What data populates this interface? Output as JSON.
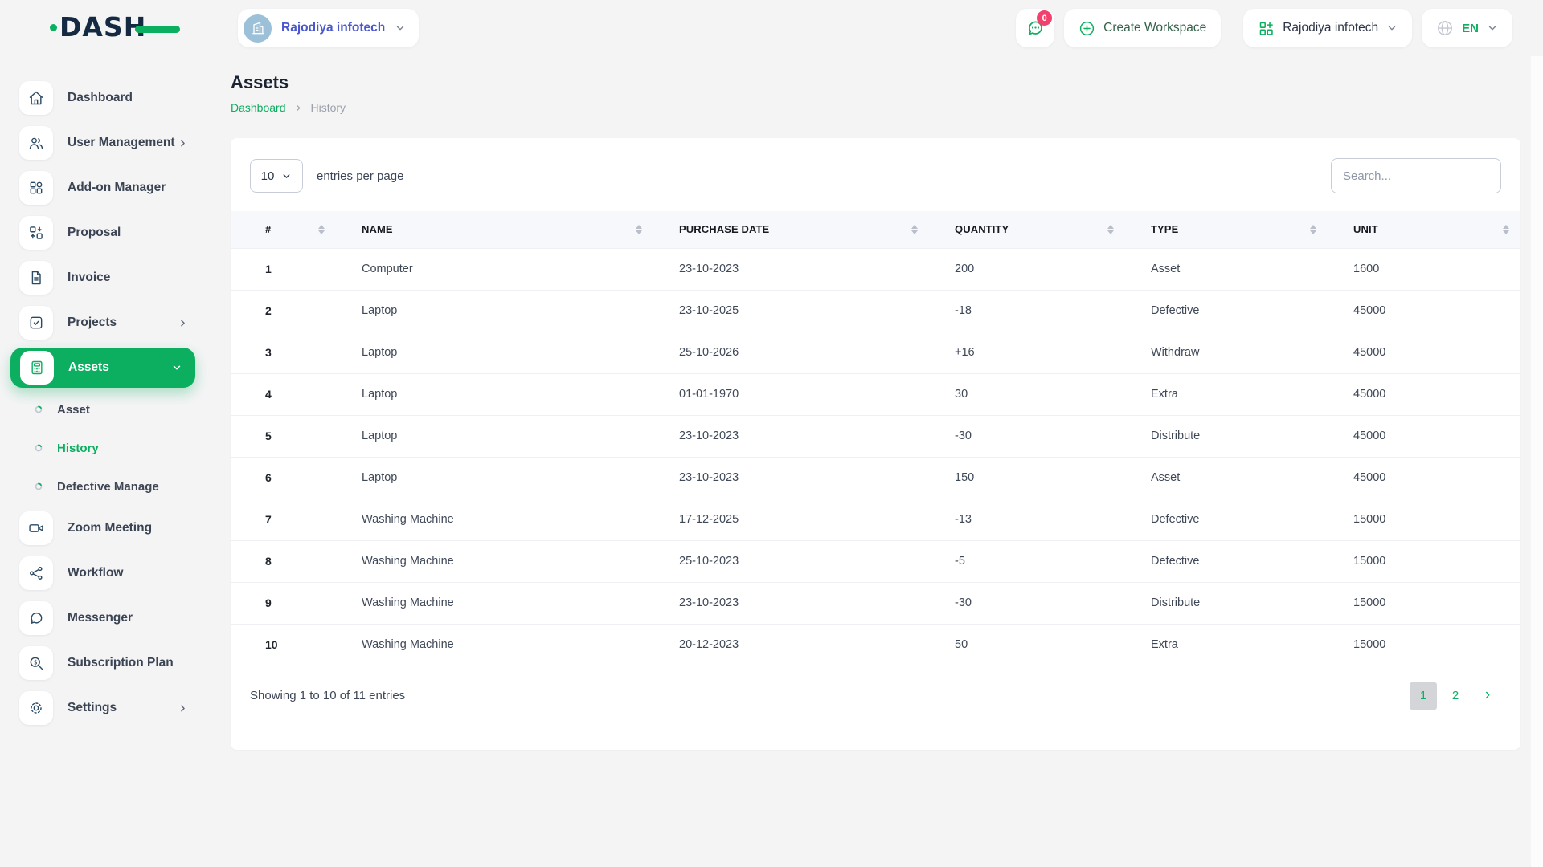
{
  "brand": {
    "name": "DASH"
  },
  "header": {
    "workspace_name": "Rajodiya infotech",
    "messages_badge": "0",
    "create_workspace_label": "Create Workspace",
    "company_name": "Rajodiya infotech",
    "language": "EN"
  },
  "sidebar": {
    "items": [
      {
        "label": "Dashboard"
      },
      {
        "label": "User Management",
        "has_children": true
      },
      {
        "label": "Add-on Manager"
      },
      {
        "label": "Proposal"
      },
      {
        "label": "Invoice"
      },
      {
        "label": "Projects",
        "has_children": true
      },
      {
        "label": "Assets",
        "active": true,
        "expanded": true
      },
      {
        "label": "Zoom Meeting"
      },
      {
        "label": "Workflow"
      },
      {
        "label": "Messenger"
      },
      {
        "label": "Subscription Plan"
      },
      {
        "label": "Settings",
        "has_children": true
      }
    ],
    "assets_submenu": [
      {
        "label": "Asset"
      },
      {
        "label": "History",
        "active": true
      },
      {
        "label": "Defective Manage"
      }
    ]
  },
  "page": {
    "title": "Assets",
    "breadcrumb": {
      "root": "Dashboard",
      "current": "History"
    }
  },
  "table": {
    "entries_per_page": "10",
    "entries_suffix": "entries per page",
    "search_placeholder": "Search...",
    "columns": [
      "#",
      "NAME",
      "PURCHASE DATE",
      "QUANTITY",
      "TYPE",
      "UNIT"
    ],
    "rows": [
      {
        "num": "1",
        "name": "Computer",
        "purchase_date": "23-10-2023",
        "quantity": "200",
        "type": "Asset",
        "unit": "1600"
      },
      {
        "num": "2",
        "name": "Laptop",
        "purchase_date": "23-10-2025",
        "quantity": "-18",
        "type": "Defective",
        "unit": "45000"
      },
      {
        "num": "3",
        "name": "Laptop",
        "purchase_date": "25-10-2026",
        "quantity": "+16",
        "type": "Withdraw",
        "unit": "45000"
      },
      {
        "num": "4",
        "name": "Laptop",
        "purchase_date": "01-01-1970",
        "quantity": "30",
        "type": "Extra",
        "unit": "45000"
      },
      {
        "num": "5",
        "name": "Laptop",
        "purchase_date": "23-10-2023",
        "quantity": "-30",
        "type": "Distribute",
        "unit": "45000"
      },
      {
        "num": "6",
        "name": "Laptop",
        "purchase_date": "23-10-2023",
        "quantity": "150",
        "type": "Asset",
        "unit": "45000"
      },
      {
        "num": "7",
        "name": "Washing Machine",
        "purchase_date": "17-12-2025",
        "quantity": "-13",
        "type": "Defective",
        "unit": "15000"
      },
      {
        "num": "8",
        "name": "Washing Machine",
        "purchase_date": "25-10-2023",
        "quantity": "-5",
        "type": "Defective",
        "unit": "15000"
      },
      {
        "num": "9",
        "name": "Washing Machine",
        "purchase_date": "23-10-2023",
        "quantity": "-30",
        "type": "Distribute",
        "unit": "15000"
      },
      {
        "num": "10",
        "name": "Washing Machine",
        "purchase_date": "20-12-2023",
        "quantity": "50",
        "type": "Extra",
        "unit": "15000"
      }
    ],
    "showing_text": "Showing 1 to 10 of 11 entries",
    "pagination": {
      "pages": [
        "1",
        "2"
      ],
      "active_page": "1",
      "next": "›"
    }
  },
  "colors": {
    "accent_green": "#0caf60",
    "badge_pink": "#f1416c",
    "brand_navy": "#132a42",
    "workspace_link_blue": "#4a57cd",
    "page_background": "#f4f4f5",
    "table_header_bg": "#f7f8fb"
  }
}
